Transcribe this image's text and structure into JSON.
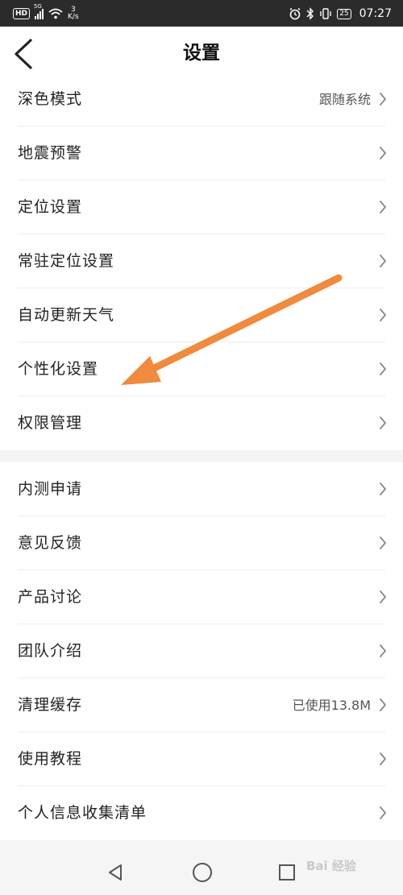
{
  "status_bar": {
    "hd": "HD",
    "network": "5G",
    "speed_value": "3",
    "speed_unit": "K/s",
    "battery": "25",
    "time": "07:27"
  },
  "header": {
    "title": "设置"
  },
  "groups": [
    {
      "items": [
        {
          "label": "深色模式",
          "value": "跟随系统"
        },
        {
          "label": "地震预警"
        },
        {
          "label": "定位设置"
        },
        {
          "label": "常驻定位设置"
        },
        {
          "label": "自动更新天气"
        },
        {
          "label": "个性化设置"
        },
        {
          "label": "权限管理"
        }
      ]
    },
    {
      "items": [
        {
          "label": "内测申请"
        },
        {
          "label": "意见反馈"
        },
        {
          "label": "产品讨论"
        },
        {
          "label": "团队介绍"
        },
        {
          "label": "清理缓存",
          "value": "已使用13.8M"
        },
        {
          "label": "使用教程"
        },
        {
          "label": "个人信息收集清单"
        }
      ]
    }
  ],
  "watermark": "Bai 经验",
  "annotation_color": "#f08a3c"
}
